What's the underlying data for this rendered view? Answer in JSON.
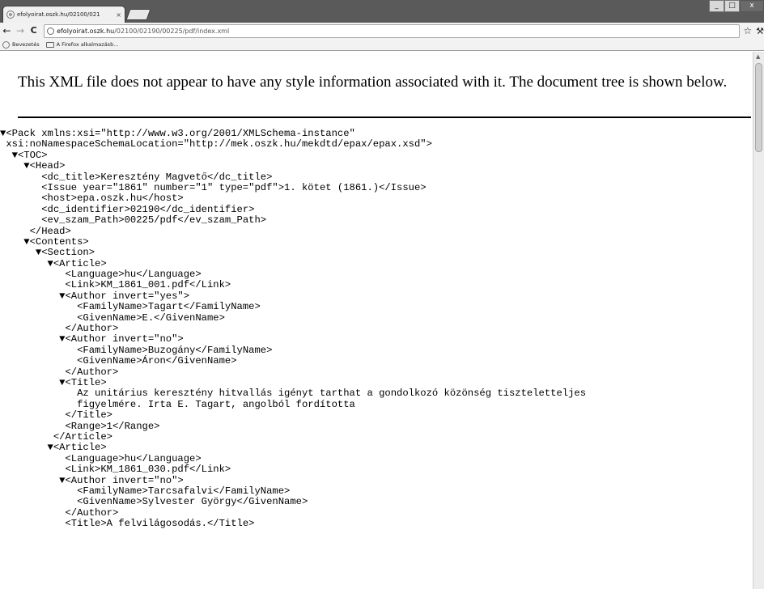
{
  "window": {
    "tab_title": "efolyoirat.oszk.hu/02100/021",
    "tab_close": "×",
    "minimize": "_",
    "maximize": "□",
    "close": "x"
  },
  "toolbar": {
    "back": "←",
    "forward": "→",
    "reload": "C",
    "url_host": "efolyoirat.oszk.hu",
    "url_path": "/02100/02190/00225/pdf/index.xml",
    "star": "☆",
    "wrench": "🔧"
  },
  "bookmarks": [
    {
      "label": "Bevezetés",
      "icon": "globe-icon"
    },
    {
      "label": "A Firefox alkalmazásb...",
      "icon": "folder-icon"
    }
  ],
  "page": {
    "notice": "This XML file does not appear to have any style information associated with it. The document tree is shown below."
  },
  "xml_lines": [
    "▼<Pack xmlns:xsi=\"http://www.w3.org/2001/XMLSchema-instance\"",
    " xsi:noNamespaceSchemaLocation=\"http://mek.oszk.hu/mekdtd/epax/epax.xsd\">",
    "  ▼<TOC>",
    "    ▼<Head>",
    "       <dc_title>Keresztény Magvető</dc_title>",
    "       <Issue year=\"1861\" number=\"1\" type=\"pdf\">1. kötet (1861.)</Issue>",
    "       <host>epa.oszk.hu</host>",
    "       <dc_identifier>02190</dc_identifier>",
    "       <ev_szam_Path>00225/pdf</ev_szam_Path>",
    "     </Head>",
    "    ▼<Contents>",
    "      ▼<Section>",
    "        ▼<Article>",
    "           <Language>hu</Language>",
    "           <Link>KM_1861_001.pdf</Link>",
    "          ▼<Author invert=\"yes\">",
    "             <FamilyName>Tagart</FamilyName>",
    "             <GivenName>E.</GivenName>",
    "           </Author>",
    "          ▼<Author invert=\"no\">",
    "             <FamilyName>Buzogány</FamilyName>",
    "             <GivenName>Áron</GivenName>",
    "           </Author>",
    "          ▼<Title>",
    "             Az unitárius keresztény hitvallás igényt tarthat a gondolkozó közönség tiszteletteljes",
    "             figyelmére. Irta E. Tagart, angolból fordította",
    "           </Title>",
    "           <Range>1</Range>",
    "         </Article>",
    "        ▼<Article>",
    "           <Language>hu</Language>",
    "           <Link>KM_1861_030.pdf</Link>",
    "          ▼<Author invert=\"no\">",
    "             <FamilyName>Tarcsafalvi</FamilyName>",
    "             <GivenName>Sylvester György</GivenName>",
    "           </Author>",
    "           <Title>A felvilágosodás.</Title>"
  ]
}
